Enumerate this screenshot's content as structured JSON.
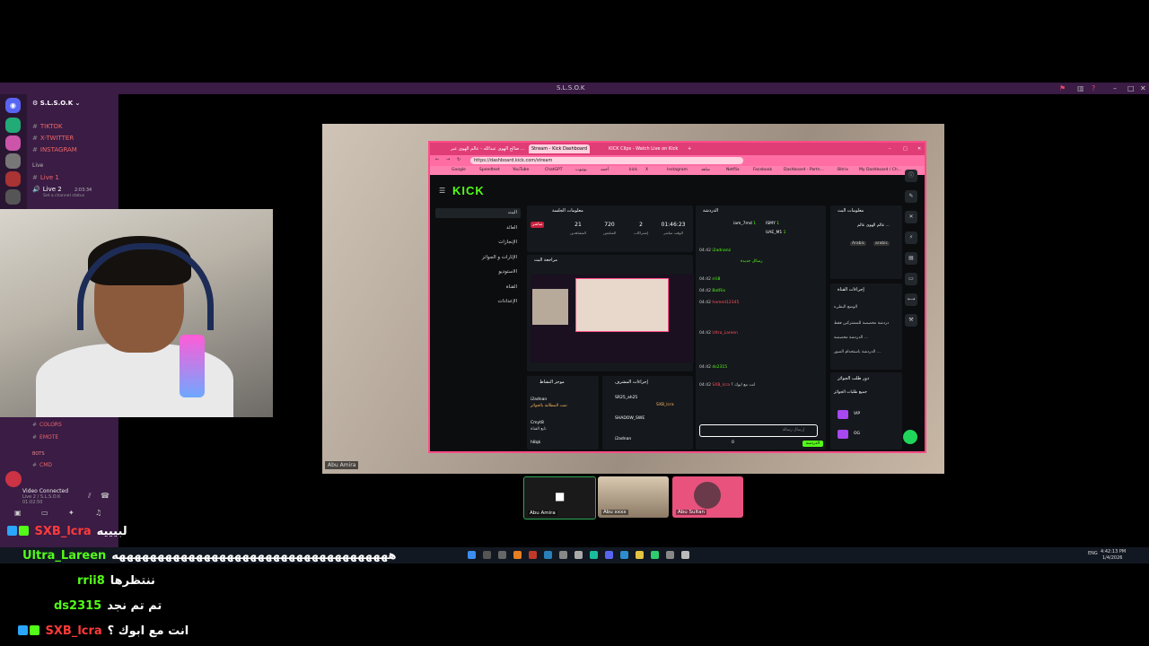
{
  "window": {
    "title": "S.L.S.O.K"
  },
  "discord": {
    "server_name": "S.L.S.O.K",
    "channels": [
      {
        "label": "TIKTOK"
      },
      {
        "label": "X-TWITTER"
      },
      {
        "label": "INSTAGRAM"
      }
    ],
    "category_live": "Live",
    "voice_channels": [
      {
        "label": "Live 1"
      },
      {
        "label": "Live 2",
        "timer": "2:03:34"
      }
    ],
    "voice_sub": "Set a channel status",
    "lower_channels": [
      {
        "label": "COLORS"
      },
      {
        "label": "EMOTE"
      }
    ],
    "category_bots": "BOTS",
    "bot_channel": "CMD",
    "video_status": "Video Connected",
    "video_sub": "Live 2 / S.L.S.O.K",
    "video_time": "01:02:50"
  },
  "stage": {
    "label": "Abu Amira"
  },
  "browser": {
    "tabs": [
      {
        "label": "صالح الهوى عبدالله - عالم الهوى عبر ..."
      },
      {
        "label": "Stream - Kick Dashboard",
        "active": true
      },
      {
        "label": "KICK Clips - Watch Live on Kick"
      }
    ],
    "url": "https://dashboard.kick.com/stream",
    "bookmarks": [
      "Google",
      "Speedtest",
      "YouTube",
      "ChatGPT",
      "يوتيوب",
      "أحمد",
      "kick",
      "X",
      "Instagram",
      "شاهد",
      "Netflix",
      "Facebook",
      "Dashboard - Partn...",
      "Bitrix",
      "My Dashboard / Ch..."
    ],
    "logo": "KICK",
    "nav": [
      {
        "label": "البث"
      },
      {
        "label": "العائد"
      },
      {
        "label": "الإنجازات"
      },
      {
        "label": "الإثارات و الجوائز"
      },
      {
        "label": "الاستوديو"
      },
      {
        "label": "القناة"
      },
      {
        "label": "الإعدادات"
      }
    ],
    "session": {
      "title": "معلومات الجلسة",
      "live_label": "مباشر",
      "stats": [
        {
          "value": "21",
          "label": "المشاهدين"
        },
        {
          "value": "720",
          "label": "المتابعين"
        },
        {
          "value": "2",
          "label": "إشتراكات"
        },
        {
          "value": "01:46:23",
          "label": "الوقت مباشر"
        }
      ]
    },
    "preview_title": "مراجعة البث",
    "activity": {
      "title": "موجز النشاط",
      "items": [
        {
          "user": "i2adnan",
          "text": "تمت المطالبة بالجوائز"
        },
        {
          "user": "Cmyt8",
          "text": "تابع القناة"
        },
        {
          "user": "h8qk",
          "text": ""
        }
      ]
    },
    "mod": {
      "title": "إجراءات المشرف",
      "items": [
        {
          "user": "SR25_ah25",
          "text": "SXB_lcra"
        },
        {
          "user": "SHADOW_SWE",
          "text": ""
        },
        {
          "user": "i2adnan",
          "text": ""
        }
      ]
    },
    "chat": {
      "title": "الدردشة",
      "top_users": [
        {
          "user": "iam_7md",
          "count": "1"
        },
        {
          "user": "ISMY",
          "count": "1"
        },
        {
          "user": "UAE_M1",
          "count": "1"
        }
      ],
      "pinned_label": "رسائل جديدة",
      "lines": [
        {
          "time": "04:42",
          "user": "i2adnanz",
          "text": ""
        },
        {
          "time": "04:42",
          "user": "rrii8",
          "text": ""
        },
        {
          "time": "04:42",
          "user": "BotRix",
          "text": ""
        },
        {
          "time": "04:42",
          "user": "hamed12345",
          "text": ""
        },
        {
          "time": "04:42",
          "user": "Ultra_Lareen",
          "text": ""
        },
        {
          "time": "04:42",
          "user": "ds2315",
          "text": ""
        },
        {
          "time": "04:42",
          "user": "SXB_lcra",
          "text": "انت مع ابوك ؟"
        }
      ],
      "input_placeholder": "إرسال رسالة",
      "send_label": "الدردشة",
      "count": "0"
    },
    "channel_info": {
      "title": "معلومات البث",
      "stream_title": "عالم الهوى عالم ...",
      "tags": [
        "Arabic",
        "arabic"
      ]
    },
    "channel_actions": {
      "title": "إجراءات القناة",
      "items": [
        "الوضع البطيء",
        "دردشة مخصصة للمشتركين فقط",
        "الدردشة مخصصة ...",
        "الدردشة باستخدام الصور ..."
      ]
    },
    "rewards": {
      "title": "دور طلب الجوائز",
      "sub": "جميع طلبات الجوائز",
      "items": [
        {
          "label": "VIP"
        },
        {
          "label": "OG"
        }
      ]
    }
  },
  "call_tiles": [
    {
      "label": "Abu Amira"
    },
    {
      "label": "Abu xxxx"
    },
    {
      "label": "Abu Sultan"
    }
  ],
  "overlay_chat": [
    {
      "user": "SXB_lcra",
      "message": "لبيييه"
    },
    {
      "user": "Ultra_Lareen",
      "message": "ههههههههههههههههههههههههههههههههههههه"
    },
    {
      "user": "rrii8",
      "message": "ننتظرها"
    },
    {
      "user": "ds2315",
      "message": "تم تم نجد"
    },
    {
      "user": "SXB_lcra",
      "message": "انت مع ابوك ؟"
    }
  ],
  "taskbar": {
    "time": "4:42:13 PM",
    "date": "1/4/2026",
    "lang": "ENG"
  },
  "colors": {
    "kick_green": "#53fc18",
    "discord_purple": "#3a1c45",
    "browser_pink": "#e03d76"
  }
}
